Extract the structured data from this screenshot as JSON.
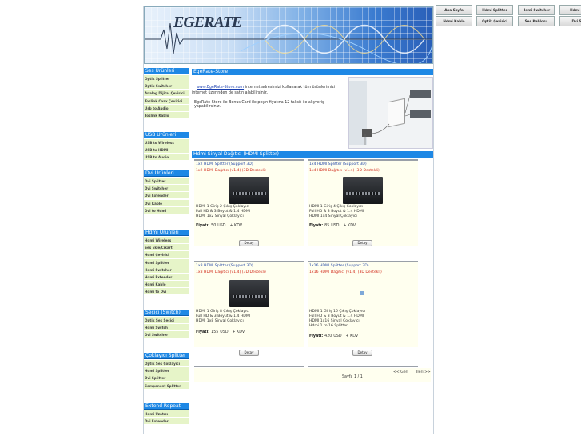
{
  "nav": {
    "row1": [
      "Ana Sayfa",
      "Hdmi Splitter",
      "Hdmi Switcher",
      "Hdmi Wi"
    ],
    "row2": [
      "Hdmi Kablo",
      "Optik Çevirici",
      "Ses Kablosu",
      "Dvi Sp"
    ]
  },
  "banner": {
    "logo": "EGERATE"
  },
  "sidebar": {
    "sections": [
      {
        "title": "Ses Ürünleri",
        "items": [
          "Optik Splitter",
          "Optik Switcher",
          "Analog Dijital Çevirici",
          "Toslink Coax Çevirici",
          "Usb to Audio",
          "Toslink Kablo"
        ]
      },
      {
        "title": "USB Ürünleri",
        "items": [
          "USB to Wireless",
          "USB to HDMI",
          "USB to Audio"
        ]
      },
      {
        "title": "Dvi Ürünleri",
        "items": [
          "Dvi Splitter",
          "Dvi Switcher",
          "Dvi Extender",
          "Dvi Kablo",
          "Dvi to Hdmi"
        ]
      },
      {
        "title": "Hdmi Ürünleri",
        "items": [
          "Hdmi Wireless",
          "Ses Ekle/Cikart",
          "Hdmi Çevirici",
          "Hdmi Splitter",
          "Hdmi Switcher",
          "Hdmi Extender",
          "Hdmi Kablo",
          "Hdmi to Dvi"
        ]
      },
      {
        "title": "Seçici (Switch)",
        "items": [
          "Optik Ses Seçici",
          "Hdmi Switch",
          "Dvi Switcher"
        ]
      },
      {
        "title": "Çoklayıcı Splitter",
        "items": [
          "Optik Ses Çoklayıcı",
          "Hdmi Splitter",
          "Dvi Splitter",
          "Component Splitter"
        ]
      },
      {
        "title": "Extend Repeat",
        "items": [
          "Hdmi Uzatıcı",
          "Dvi Extender"
        ]
      }
    ]
  },
  "store": {
    "title": "EgeRate-Store",
    "link": "www.EgeRate-Store.com",
    "text1": " internet adresimizi kullanarak tüm ürünlerimizi internet üzerinden de satın alabilirsiniz.",
    "text2": "EgeRate-Store ile Bonus Card ile peşin fiyatına 12 taksit ile alışveriş yapabilirsiniz."
  },
  "section_title": "Hdmi Sinyal Dağıtıcı (HDMI Splitter)",
  "products": [
    {
      "name": "1x2 HDMI Splitter (Support 3D)",
      "sub": "1x2 HDMI Dağıtıcı (v1.4) (3D Destekli)",
      "desc": [
        "HDMI 1 Giriş 2 Çıkış Çoklayıcı",
        "Full HD & 3 Boyut & 1.4 HDMI",
        "HDMI 1x2 Sinyal Çoklayıcı"
      ],
      "price_label": "Fiyatı:",
      "price": "50",
      "currency": "USD",
      "tax": "+ KDV",
      "button": "Detay"
    },
    {
      "name": "1x4 HDMI Splitter (Support 3D)",
      "sub": "1x4 HDMI Dağıtıcı (v1.4) (3D Destekli)",
      "desc": [
        "HDMI 1 Giriş 4 Çıkış Çoklayıcı",
        "Full HD & 3 Boyut & 1.4 HDMI",
        "HDMI 1x4 Sinyal Çoklayıcı"
      ],
      "price_label": "Fiyatı:",
      "price": "85",
      "currency": "USD",
      "tax": "+ KDV",
      "button": "Detay"
    },
    {
      "name": "1x8 HDMI Splitter (Support 3D)",
      "sub": "1x8 HDMI Dağıtıcı (v1.4) (3D Destekli)",
      "desc": [
        "HDMI 1 Giriş 8 Çıkış Çoklayıcı",
        "Full HD & 3 Boyut & 1.4 HDMI",
        "HDMI 1x8 Sinyal Çoklayıcı"
      ],
      "price_label": "Fiyatı:",
      "price": "155",
      "currency": "USD",
      "tax": "+ KDV",
      "button": "Detay"
    },
    {
      "name": "1x16 HDMI Splitter (Support 3D)",
      "sub": "1x16 HDMI Dağıtıcı (v1.4) (3D Destekli)",
      "desc": [
        "HDMI 1 Giriş 16 Çıkış Çoklayıcı",
        "Full HD & 3 Boyut & 1.4 HDMI",
        "HDMI 1x16 Sinyal Çoklayıcı",
        "Hdmi 1 to 16 Splitter"
      ],
      "price_label": "Fiyatı:",
      "price": "420",
      "currency": "USD",
      "tax": "+ KDV",
      "button": "Detay"
    }
  ],
  "pager": {
    "prev": "<< Geri",
    "next": "İleri >>",
    "page_label": "Sayfa 1 / 1"
  }
}
